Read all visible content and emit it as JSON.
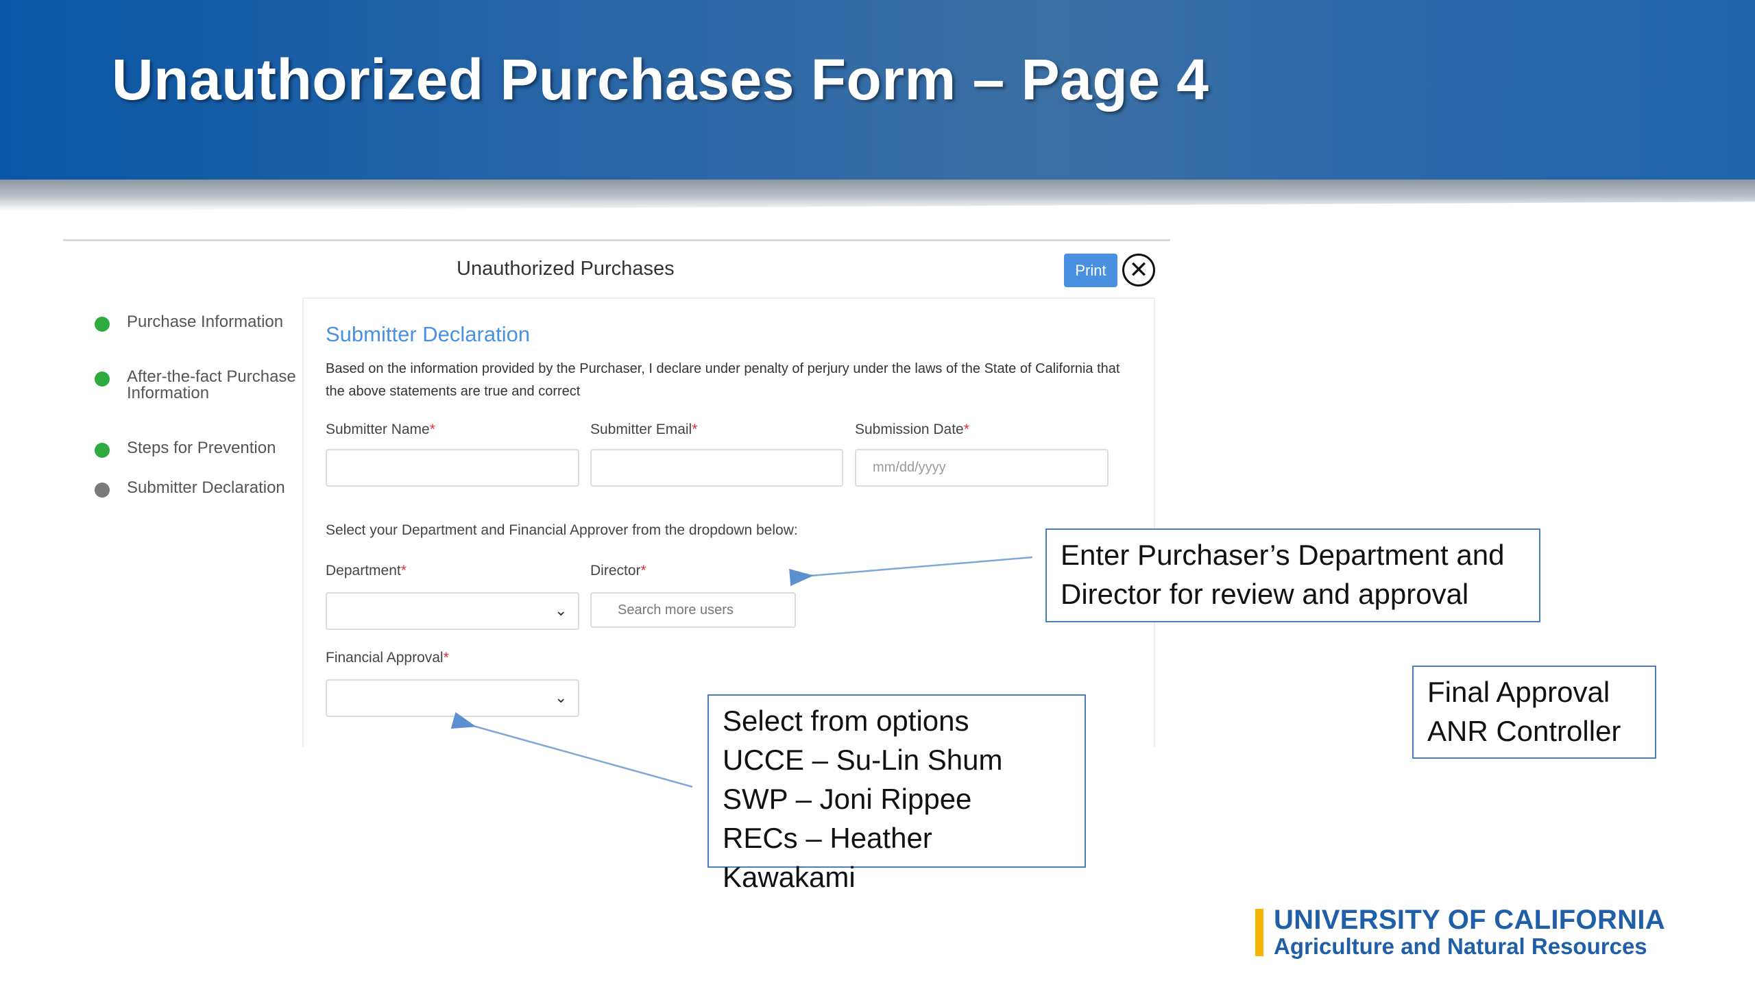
{
  "slide": {
    "title": "Unauthorized Purchases Form – Page 4"
  },
  "form": {
    "window_title": "Unauthorized Purchases",
    "print_label": "Print",
    "close_glyph": "✕",
    "steps": [
      {
        "label": "Purchase Information",
        "status": "complete"
      },
      {
        "label": "After-the-fact Purchase Information",
        "status": "complete"
      },
      {
        "label": "Steps for Prevention",
        "status": "complete"
      },
      {
        "label": "Submitter Declaration",
        "status": "current"
      }
    ],
    "section_title": "Submitter Declaration",
    "declaration_text": "Based on the information provided by the Purchaser, I declare under penalty of perjury under the laws of the State of California that the above statements are true and correct",
    "fields": {
      "submitter_name": {
        "label": "Submitter Name",
        "value": ""
      },
      "submitter_email": {
        "label": "Submitter Email",
        "value": ""
      },
      "submission_date": {
        "label": "Submission Date",
        "placeholder": "mm/dd/yyyy"
      }
    },
    "dept_instructions": "Select your Department and Financial Approver from the dropdown below:",
    "department": {
      "label": "Department",
      "value": ""
    },
    "director": {
      "label": "Director",
      "placeholder": "Search more users"
    },
    "financial_approval": {
      "label": "Financial Approval",
      "value": ""
    },
    "required_marker": "*",
    "chevron_glyph": "⌄"
  },
  "callouts": {
    "dept_director": {
      "lines": [
        "Enter Purchaser’s Department and",
        "Director for review and approval"
      ]
    },
    "options": {
      "lines": [
        "Select from options",
        "UCCE – Su-Lin Shum",
        "SWP – Joni Rippee",
        "RECs – Heather Kawakami"
      ]
    },
    "final": {
      "lines": [
        "Final Approval",
        "ANR Controller"
      ]
    }
  },
  "logo": {
    "line1": "UNIVERSITY OF CALIFORNIA",
    "line2": "Agriculture and Natural Resources"
  },
  "colors": {
    "banner_blue": "#0a56a6",
    "link_blue": "#4a90e2",
    "step_complete": "#2eaa3f",
    "step_current": "#7a7a7a",
    "required_red": "#e03030",
    "logo_blue": "#1f5fa8",
    "logo_gold": "#f5b400"
  }
}
